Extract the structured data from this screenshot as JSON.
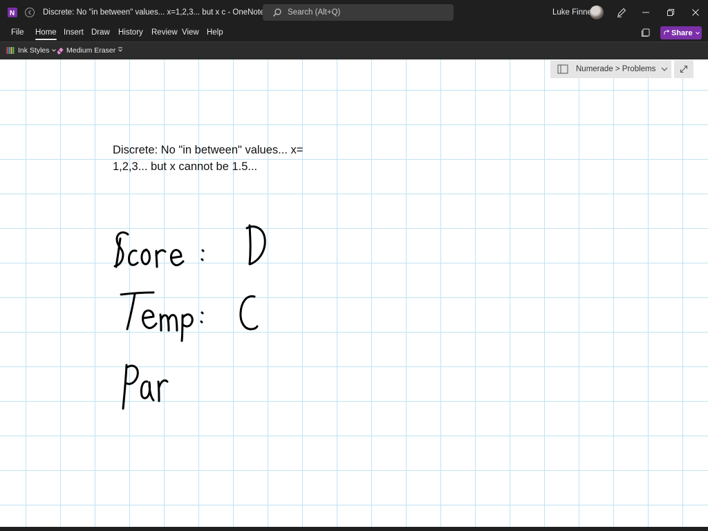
{
  "window": {
    "title": "Discrete: No \"in between\" values... x=1,2,3... but x c  -  OneNote",
    "search_placeholder": "Search (Alt+Q)",
    "user_name": "Luke Finney"
  },
  "menu": {
    "items": [
      "File",
      "Home",
      "Insert",
      "Draw",
      "History",
      "Review",
      "View",
      "Help"
    ],
    "active": "Home",
    "share_label": "Share"
  },
  "toolbar": {
    "ink_styles": "Ink Styles",
    "eraser": "Medium Eraser"
  },
  "page": {
    "notebook_path": "Numerade > Problems",
    "typed_note": "Discrete: No \"in between\" values... x= 1,2,3... but x cannot be 1.5..."
  },
  "colors": {
    "titlebar_bg": "#1f1f1f",
    "toolbar_bg": "#2c2c2c",
    "share_accent": "#7b2fa8",
    "grid_line": "#bfe3f2",
    "ink": "#000000"
  },
  "icons": [
    "onenote-icon",
    "back-icon",
    "search-icon",
    "pen-icon",
    "minimize-icon",
    "restore-icon",
    "close-icon",
    "sync-icon",
    "ink-styles-icon",
    "eraser-icon",
    "dropdown-icon",
    "notebook-icon",
    "chevron-down-icon",
    "expand-icon"
  ]
}
